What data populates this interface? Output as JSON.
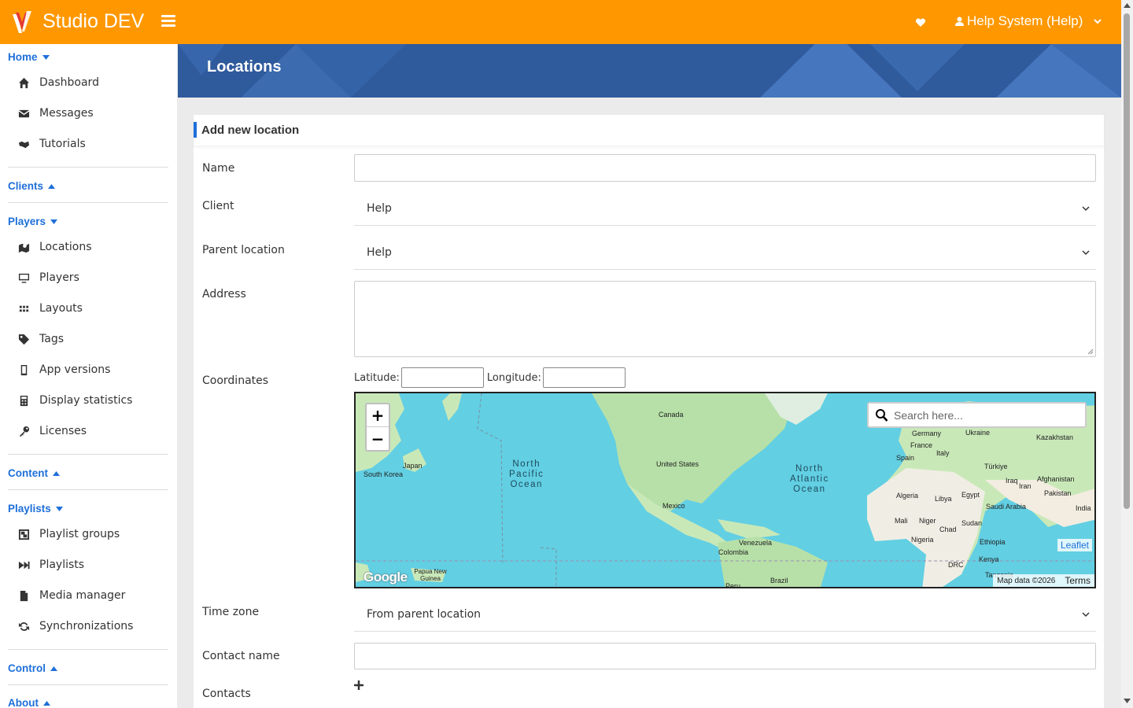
{
  "app": {
    "brand": "Studio DEV",
    "user": "Help System (Help)"
  },
  "sidebar": {
    "home": "Home",
    "home_items": [
      "Dashboard",
      "Messages",
      "Tutorials"
    ],
    "clients": "Clients",
    "players": "Players",
    "players_items": [
      "Locations",
      "Players",
      "Layouts",
      "Tags",
      "App versions",
      "Display statistics",
      "Licenses"
    ],
    "content": "Content",
    "playlists": "Playlists",
    "playlists_items": [
      "Playlist groups",
      "Playlists",
      "Media manager",
      "Synchronizations"
    ],
    "control": "Control",
    "about": "About"
  },
  "page": {
    "title": "Locations",
    "panel_title": "Add new location"
  },
  "form": {
    "name_label": "Name",
    "name_value": "",
    "client_label": "Client",
    "client_value": "Help",
    "parent_label": "Parent location",
    "parent_value": "Help",
    "address_label": "Address",
    "address_value": "",
    "coords_label": "Coordinates",
    "lat_label": "Latitude:",
    "lon_label": "Longitude:",
    "timezone_label": "Time zone",
    "timezone_value": "From parent location",
    "contact_name_label": "Contact name",
    "contact_name_value": "",
    "contacts_label": "Contacts"
  },
  "map": {
    "search_placeholder": "Search here...",
    "zoom_in": "+",
    "zoom_out": "−",
    "leaflet": "Leaflet",
    "map_data": "Map data ©2026",
    "terms": "Terms",
    "google": "Google",
    "labels": [
      "Canada",
      "United States",
      "Mexico",
      "Japan",
      "South Korea",
      "Germany",
      "Ukraine",
      "Kazakhstan",
      "France",
      "Italy",
      "Spain",
      "Türkiye",
      "Iraq",
      "Iran",
      "Afghanistan",
      "Pakistan",
      "India",
      "Algeria",
      "Libya",
      "Egypt",
      "Saudi Arabia",
      "Mali",
      "Niger",
      "Sudan",
      "Chad",
      "Nigeria",
      "Ethiopia",
      "Kenya",
      "DRC",
      "Tanzania",
      "Venezuela",
      "Colombia",
      "Brazil",
      "Peru",
      "Papua New Guinea"
    ],
    "oceans": [
      "North\nPacific\nOcean",
      "North\nAtlantic\nOcean"
    ]
  },
  "colors": {
    "topbar": "#ff9800",
    "accent": "#1e6fd9",
    "banner": "#2f5a9c",
    "water": "#62cfe3",
    "land": "#c9e8b8"
  }
}
